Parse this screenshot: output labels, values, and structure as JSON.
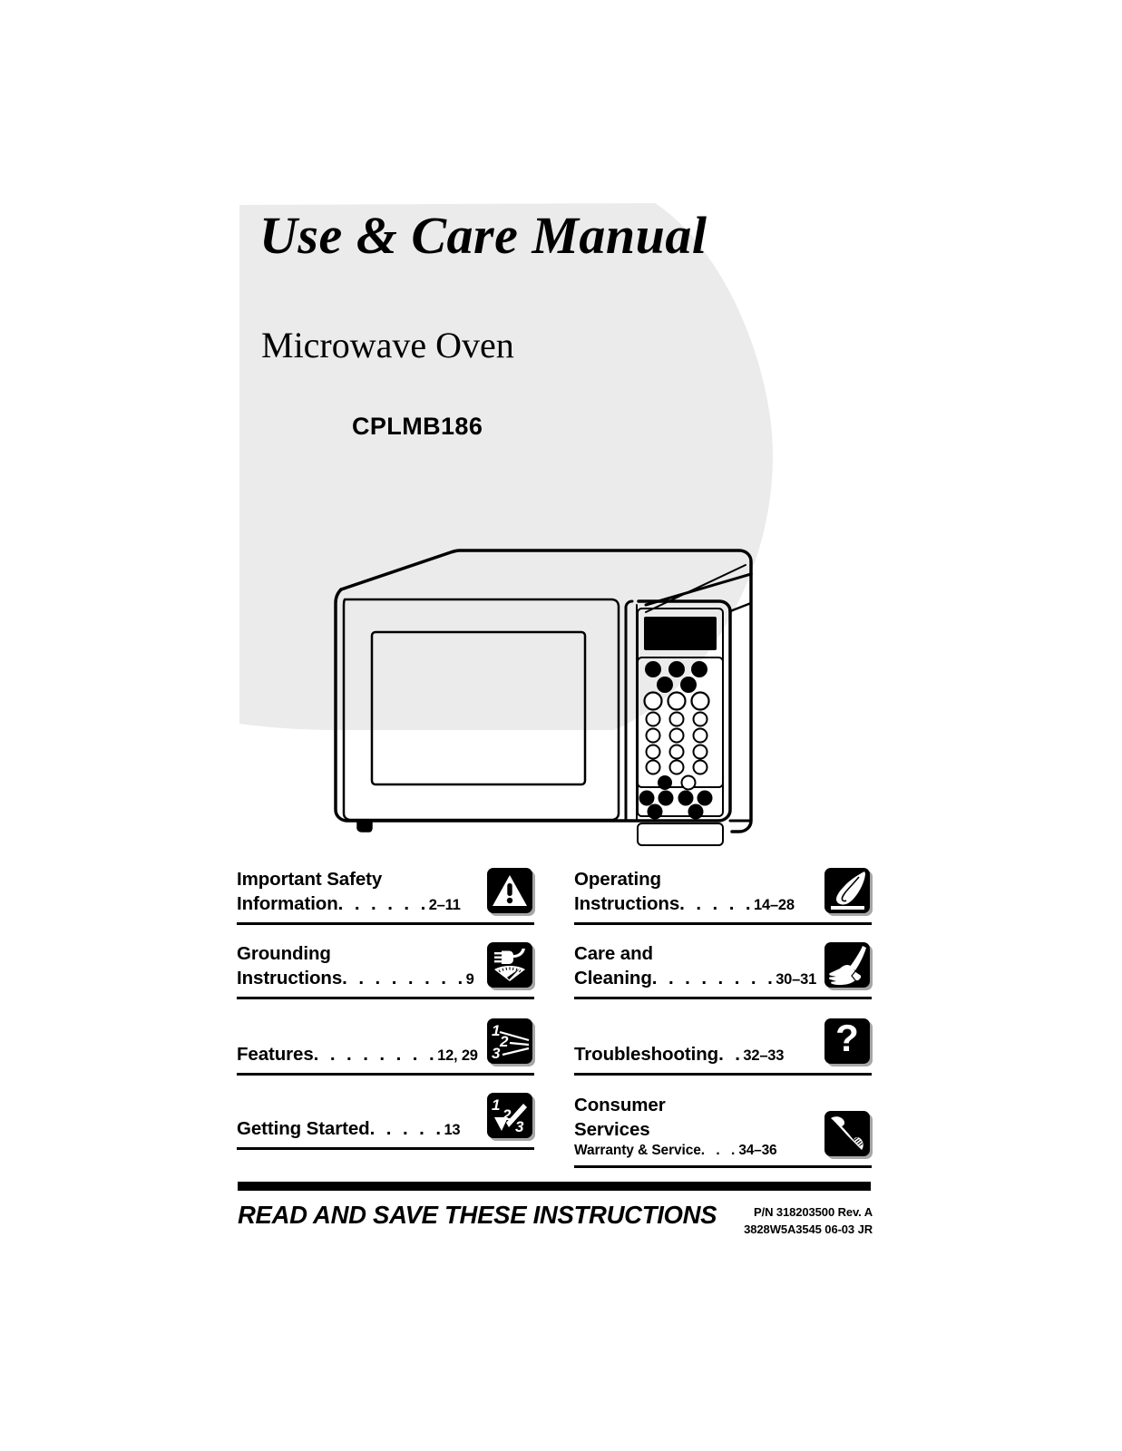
{
  "cover": {
    "manual_title": "Use & Care Manual",
    "product_type": "Microwave Oven",
    "model_number": "CPLMB186"
  },
  "illustration": {
    "name": "microwave-oven-line-drawing",
    "alt": "Countertop microwave oven with door window, digital display and keypad control panel"
  },
  "toc": {
    "left_column": [
      {
        "id": "important-safety-information",
        "line1": "Important Safety",
        "line2": "Information",
        "leader": ". . . . . .",
        "pages": "2–11",
        "icon": "warning-triangle-icon"
      },
      {
        "id": "grounding-instructions",
        "line1": "Grounding",
        "line2": "Instructions",
        "leader": ". . . . . . . .",
        "pages": "9",
        "icon": "plug-meter-icon"
      },
      {
        "id": "features",
        "line1": "",
        "line2": "Features",
        "leader": ". . . . . . . .",
        "pages": "12, 29",
        "icon": "numbered-callouts-icon"
      },
      {
        "id": "getting-started",
        "line1": "",
        "line2": "Getting Started",
        "leader": ". . . . .",
        "pages": "13",
        "icon": "numbered-steps-check-icon"
      }
    ],
    "right_column": [
      {
        "id": "operating-instructions",
        "line1": "Operating",
        "line2": "Instructions",
        "leader": ". . . . .",
        "pages": "14–28",
        "icon": "finger-press-button-icon"
      },
      {
        "id": "care-and-cleaning",
        "line1": "Care and",
        "line2": "Cleaning",
        "leader": ". . . . . . . .",
        "pages": "30–31",
        "icon": "hand-wiping-cloth-icon"
      },
      {
        "id": "troubleshooting",
        "line1": "",
        "line2": "Troubleshooting",
        "leader": ". .",
        "pages": "32–33",
        "icon": "question-mark-icon"
      },
      {
        "id": "consumer-services",
        "line1": "Consumer",
        "line2": "Services",
        "sub_label": "Warranty & Service",
        "sub_leader": ". . .",
        "sub_pages": "34–36",
        "icon": "telephone-handset-icon"
      }
    ]
  },
  "footer": {
    "read_save": "READ AND SAVE THESE INSTRUCTIONS",
    "part_number": "P/N 318203500 Rev. A",
    "doc_code": "3828W5A3545  06-03 JR"
  },
  "colors": {
    "ink": "#000000",
    "paper": "#ffffff",
    "blob_gray": "#ebebeb",
    "icon_shadow": "#969696"
  }
}
